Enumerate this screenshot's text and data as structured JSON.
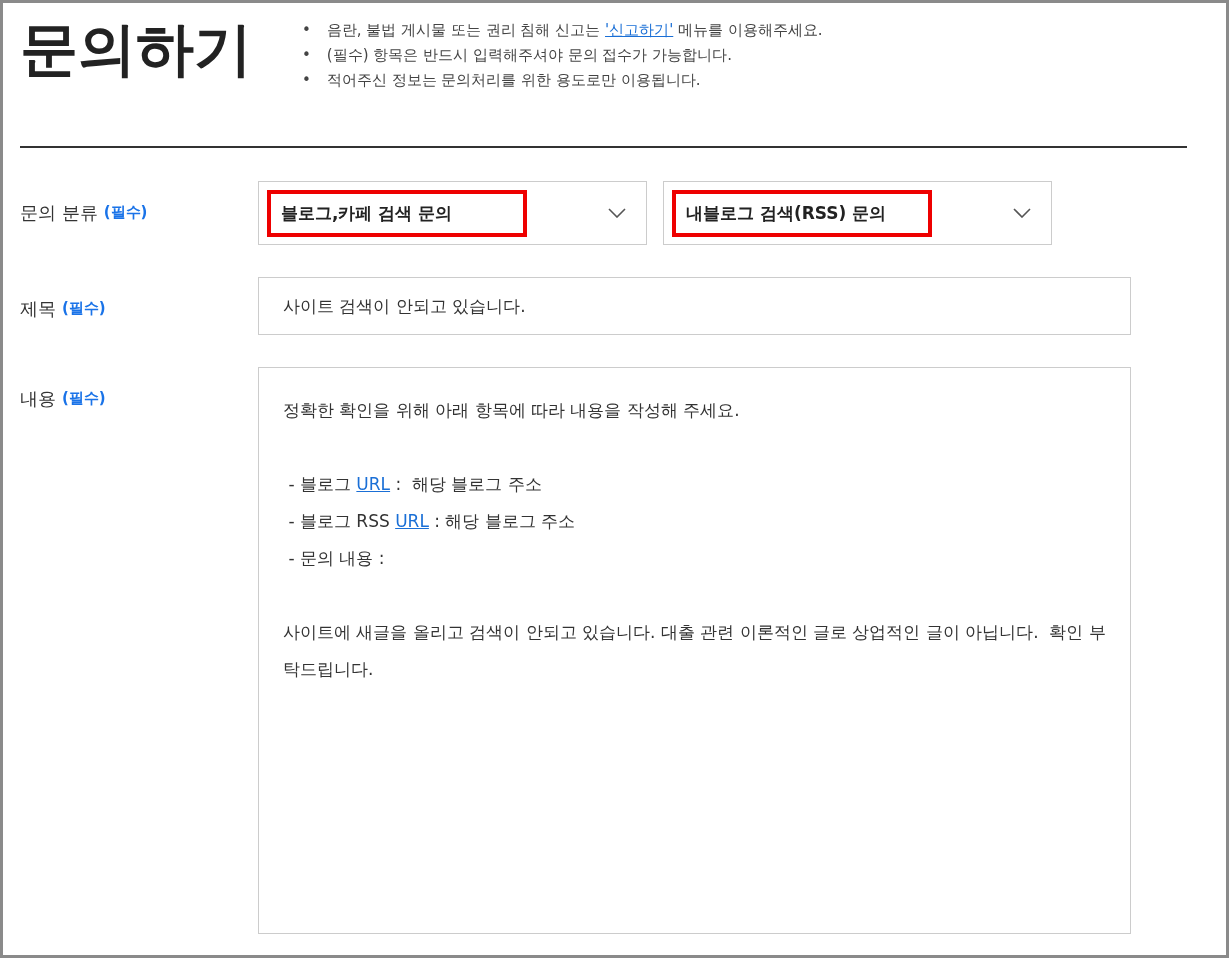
{
  "page_title": "문의하기",
  "notes": [
    {
      "bullet": "•",
      "text": "음란, 불법 게시물 또는 권리 침해 신고는 ",
      "link": "'신고하기'",
      "suffix": " 메뉴를 이용해주세요."
    },
    {
      "bullet": "•",
      "text": "(필수) 항목은 반드시 입력해주셔야 문의 접수가 가능합니다."
    },
    {
      "bullet": "•",
      "text": "적어주신 정보는 문의처리를 위한 용도로만 이용됩니다."
    }
  ],
  "form": [
    {
      "kind": "selects",
      "label": "문의 분류",
      "required": "(필수)",
      "selects": [
        {
          "value": "블로그,카페 검색 문의",
          "highlighted": true
        },
        {
          "value": "내블로그 검색(RSS) 문의",
          "highlighted": true
        }
      ]
    },
    {
      "kind": "input",
      "label": "제목",
      "required": "(필수)",
      "value": "사이트 검색이 안되고 있습니다."
    },
    {
      "kind": "textarea",
      "label": "내용",
      "required": "(필수)",
      "paragraphs": [
        [
          {
            "text": "정확한 확인을 위해 아래 항목에 따라 내용을 작성해 주세요."
          }
        ],
        [
          {
            "text": " - 블로그 ",
            "link": "URL",
            "suffix": " :  해당 블로그 주소"
          },
          {
            "text": " - 블로그 RSS ",
            "link": "URL",
            "suffix": " : 해당 블로그 주소"
          },
          {
            "text": " - 문의 내용 :"
          }
        ],
        [
          {
            "text": "사이트에 새글을 올리고 검색이 안되고 있습니다. 대출 관련 이론적인 글로 상업적인 글이 아닙니다.  확인 부탁드립니다."
          }
        ]
      ]
    }
  ]
}
